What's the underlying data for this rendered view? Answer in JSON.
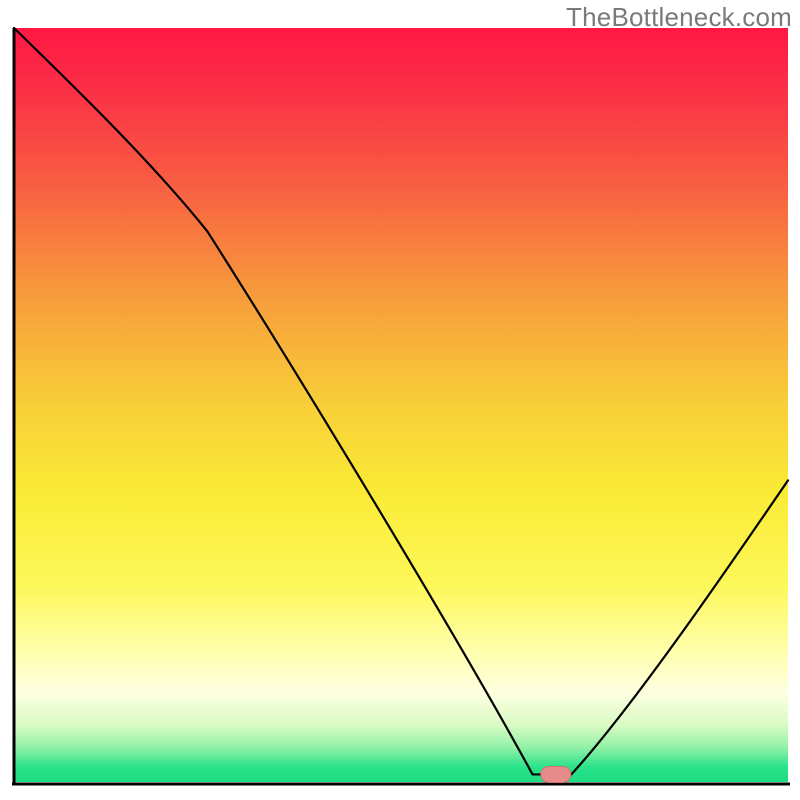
{
  "watermark": "TheBottleneck.com",
  "chart_data": {
    "type": "line",
    "title": "",
    "xlabel": "",
    "ylabel": "",
    "xlim": [
      0,
      100
    ],
    "ylim": [
      0,
      100
    ],
    "x": [
      0,
      25,
      67,
      72,
      100
    ],
    "values": [
      100,
      73,
      1,
      1,
      40
    ],
    "colors": {
      "gradient_stops": [
        {
          "offset": 0.0,
          "color": "#ff1744"
        },
        {
          "offset": 0.08,
          "color": "#fb2f46"
        },
        {
          "offset": 0.2,
          "color": "#f85b42"
        },
        {
          "offset": 0.35,
          "color": "#f79a3c"
        },
        {
          "offset": 0.5,
          "color": "#f8cf38"
        },
        {
          "offset": 0.62,
          "color": "#faeb36"
        },
        {
          "offset": 0.74,
          "color": "#fdf85a"
        },
        {
          "offset": 0.82,
          "color": "#ffffa6"
        },
        {
          "offset": 0.88,
          "color": "#ffffe0"
        },
        {
          "offset": 0.925,
          "color": "#d8fbc4"
        },
        {
          "offset": 0.955,
          "color": "#8ff0a6"
        },
        {
          "offset": 0.98,
          "color": "#2be38a"
        },
        {
          "offset": 1.0,
          "color": "#1cdc80"
        }
      ],
      "marker": {
        "fill": "#e58b8b",
        "stroke": "#d86f6f"
      }
    },
    "marker_point": {
      "x": 70,
      "y": 1
    }
  }
}
